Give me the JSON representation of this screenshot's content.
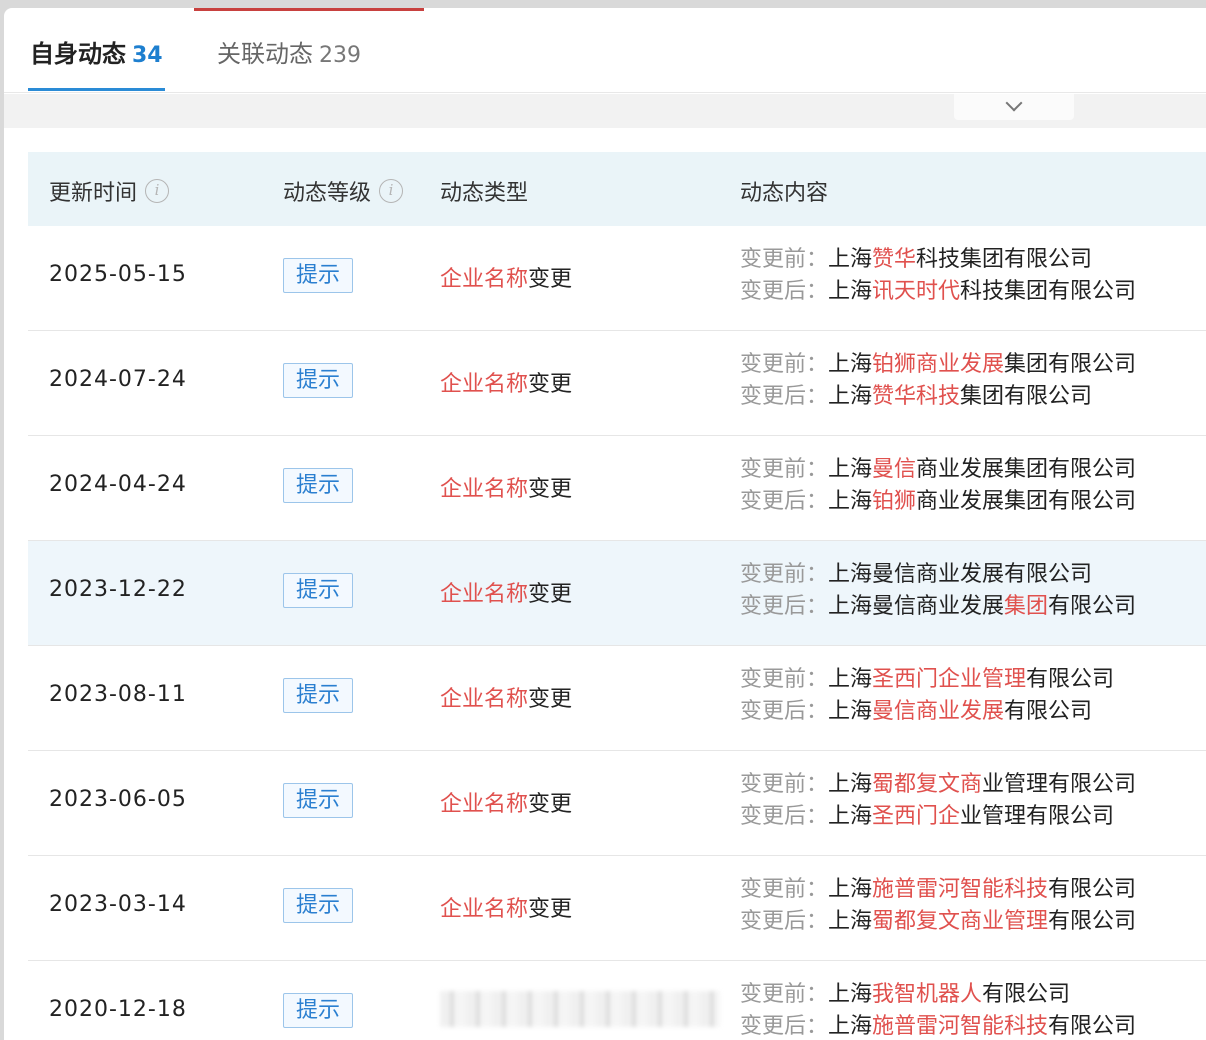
{
  "tabs": [
    {
      "label": "自身动态",
      "count": "34"
    },
    {
      "label": "关联动态",
      "count": "239"
    }
  ],
  "headers": {
    "time": "更新时间",
    "level": "动态等级",
    "type": "动态类型",
    "content": "动态内容"
  },
  "labels": {
    "before": "变更前：",
    "after": "变更后："
  },
  "rows": [
    {
      "date": "2025-05-15",
      "level": "提示",
      "type": [
        [
          "企业名称",
          "r"
        ],
        [
          "变更",
          "n"
        ]
      ],
      "before": [
        [
          "上海",
          "n"
        ],
        [
          "赞华",
          "r"
        ],
        [
          "科技集团有限公司",
          "n"
        ]
      ],
      "after": [
        [
          "上海",
          "n"
        ],
        [
          "讯天时代",
          "r"
        ],
        [
          "科技集团有限公司",
          "n"
        ]
      ]
    },
    {
      "date": "2024-07-24",
      "level": "提示",
      "type": [
        [
          "企业名称",
          "r"
        ],
        [
          "变更",
          "n"
        ]
      ],
      "before": [
        [
          "上海",
          "n"
        ],
        [
          "铂狮商业发展",
          "r"
        ],
        [
          "集团有限公司",
          "n"
        ]
      ],
      "after": [
        [
          "上海",
          "n"
        ],
        [
          "赞华科技",
          "r"
        ],
        [
          "集团有限公司",
          "n"
        ]
      ]
    },
    {
      "date": "2024-04-24",
      "level": "提示",
      "type": [
        [
          "企业名称",
          "r"
        ],
        [
          "变更",
          "n"
        ]
      ],
      "before": [
        [
          "上海",
          "n"
        ],
        [
          "曼信",
          "r"
        ],
        [
          "商业发展集团有限公司",
          "n"
        ]
      ],
      "after": [
        [
          "上海",
          "n"
        ],
        [
          "铂狮",
          "r"
        ],
        [
          "商业发展集团有限公司",
          "n"
        ]
      ]
    },
    {
      "date": "2023-12-22",
      "level": "提示",
      "type": [
        [
          "企业名称",
          "r"
        ],
        [
          "变更",
          "n"
        ]
      ],
      "before": [
        [
          "上海曼信商业发展有限公司",
          "n"
        ]
      ],
      "after": [
        [
          "上海曼信商业发展",
          "n"
        ],
        [
          "集团",
          "r"
        ],
        [
          "有限公司",
          "n"
        ]
      ]
    },
    {
      "date": "2023-08-11",
      "level": "提示",
      "type": [
        [
          "企业名称",
          "r"
        ],
        [
          "变更",
          "n"
        ]
      ],
      "before": [
        [
          "上海",
          "n"
        ],
        [
          "圣西门企业管理",
          "r"
        ],
        [
          "有限公司",
          "n"
        ]
      ],
      "after": [
        [
          "上海",
          "n"
        ],
        [
          "曼信商业发展",
          "r"
        ],
        [
          "有限公司",
          "n"
        ]
      ]
    },
    {
      "date": "2023-06-05",
      "level": "提示",
      "type": [
        [
          "企业名称",
          "r"
        ],
        [
          "变更",
          "n"
        ]
      ],
      "before": [
        [
          "上海",
          "n"
        ],
        [
          "蜀都复文商",
          "r"
        ],
        [
          "业管理有限公司",
          "n"
        ]
      ],
      "after": [
        [
          "上海",
          "n"
        ],
        [
          "圣西门企",
          "r"
        ],
        [
          "业管理有限公司",
          "n"
        ]
      ]
    },
    {
      "date": "2023-03-14",
      "level": "提示",
      "type": [
        [
          "企业名称",
          "r"
        ],
        [
          "变更",
          "n"
        ]
      ],
      "before": [
        [
          "上海",
          "n"
        ],
        [
          "施普雷河智能科技",
          "r"
        ],
        [
          "有限公司",
          "n"
        ]
      ],
      "after": [
        [
          "上海",
          "n"
        ],
        [
          "蜀都复文商业管理",
          "r"
        ],
        [
          "有限公司",
          "n"
        ]
      ]
    },
    {
      "date": "2020-12-18",
      "level": "提示",
      "type": [],
      "before": [
        [
          "上海",
          "n"
        ],
        [
          "我智机器人",
          "r"
        ],
        [
          "有限公司",
          "n"
        ]
      ],
      "after": [
        [
          "上海",
          "n"
        ],
        [
          "施普雷河智能科技",
          "r"
        ],
        [
          "有限公司",
          "n"
        ]
      ]
    }
  ],
  "colors": {
    "accent": "#2a8bd6",
    "highlight": "#e0514e",
    "header_bg": "#eaf4f8"
  },
  "icons": {
    "info": "info-icon",
    "dropdown": "chevron-down-icon"
  }
}
